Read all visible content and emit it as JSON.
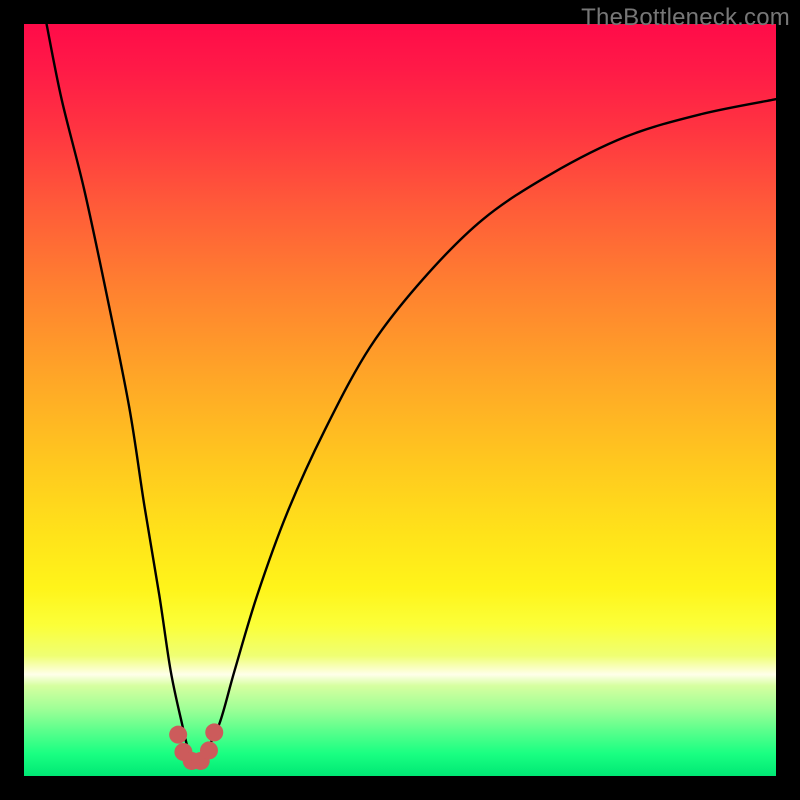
{
  "watermark": "TheBottleneck.com",
  "chart_data": {
    "type": "line",
    "title": "",
    "xlabel": "",
    "ylabel": "",
    "xlim": [
      0,
      100
    ],
    "ylim": [
      0,
      100
    ],
    "series": [
      {
        "name": "bottleneck-curve",
        "x": [
          3,
          5,
          8,
          11,
          14,
          16,
          18,
          19.5,
          21,
          22,
          23,
          24,
          26,
          28,
          31,
          35,
          40,
          46,
          53,
          61,
          70,
          80,
          90,
          100
        ],
        "values": [
          100,
          90,
          78,
          64,
          49,
          36,
          24,
          14,
          7,
          3,
          2,
          3,
          7,
          14,
          24,
          35,
          46,
          57,
          66,
          74,
          80,
          85,
          88,
          90
        ]
      }
    ],
    "markers": {
      "name": "bottleneck-floor-dots",
      "color": "#cc5b5b",
      "points": [
        {
          "x": 20.5,
          "y": 5.5
        },
        {
          "x": 21.2,
          "y": 3.2
        },
        {
          "x": 22.3,
          "y": 2.0
        },
        {
          "x": 23.5,
          "y": 2.0
        },
        {
          "x": 24.6,
          "y": 3.4
        },
        {
          "x": 25.3,
          "y": 5.8
        }
      ]
    }
  },
  "colors": {
    "curve_stroke": "#000000",
    "marker_fill": "#cc5b5b",
    "background_black": "#000000"
  }
}
